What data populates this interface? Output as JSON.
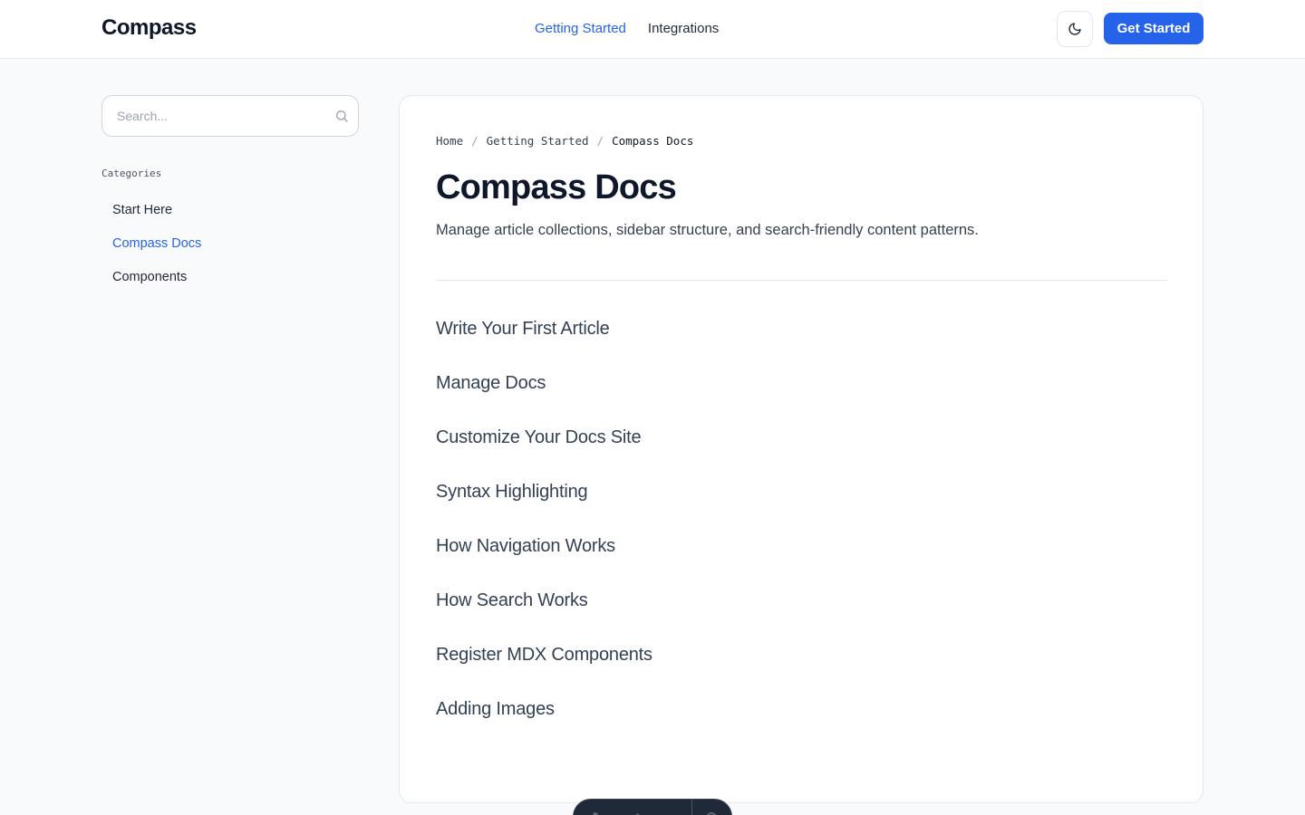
{
  "header": {
    "logo": "Compass",
    "nav": [
      {
        "label": "Getting Started",
        "active": true
      },
      {
        "label": "Integrations",
        "active": false
      }
    ],
    "theme_toggle_icon": "moon-icon",
    "cta_label": "Get Started"
  },
  "sidebar": {
    "search": {
      "placeholder": "Search...",
      "value": ""
    },
    "categories_label": "Categories",
    "categories": [
      {
        "label": "Start Here",
        "active": false
      },
      {
        "label": "Compass Docs",
        "active": true
      },
      {
        "label": "Components",
        "active": false
      }
    ]
  },
  "main": {
    "breadcrumb": [
      "Home",
      "Getting Started",
      "Compass Docs"
    ],
    "title": "Compass Docs",
    "description": "Manage article collections, sidebar structure, and search-friendly content patterns.",
    "articles": [
      "Write Your First Article",
      "Manage Docs",
      "Customize Your Docs Site",
      "Syntax Highlighting",
      "How Navigation Works",
      "How Search Works",
      "Register MDX Components",
      "Adding Images"
    ]
  },
  "colors": {
    "accent": "#2563eb",
    "background": "#f8fafc",
    "text": "#0f172a"
  }
}
